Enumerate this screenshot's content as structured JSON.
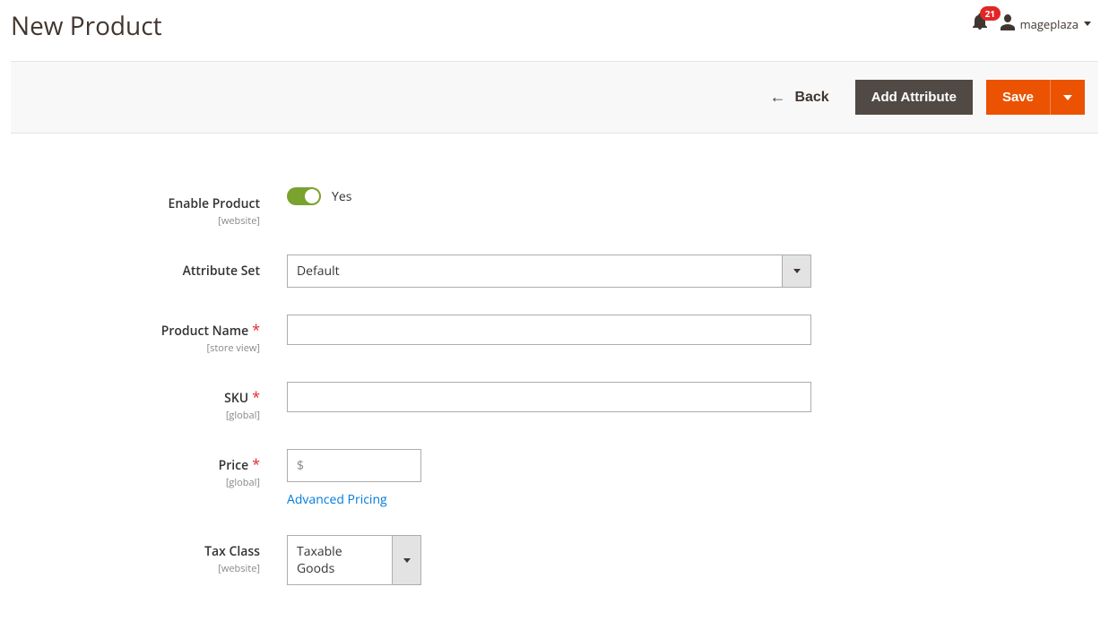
{
  "header": {
    "title": "New Product",
    "notification_count": "21",
    "username": "mageplaza"
  },
  "actions": {
    "back": "Back",
    "add_attribute": "Add Attribute",
    "save": "Save"
  },
  "form": {
    "enable_product": {
      "label": "Enable Product",
      "scope": "[website]",
      "value_label": "Yes"
    },
    "attribute_set": {
      "label": "Attribute Set",
      "value": "Default"
    },
    "product_name": {
      "label": "Product Name",
      "scope": "[store view]",
      "value": ""
    },
    "sku": {
      "label": "SKU",
      "scope": "[global]",
      "value": ""
    },
    "price": {
      "label": "Price",
      "scope": "[global]",
      "prefix": "$",
      "value": "",
      "advanced_link": "Advanced Pricing"
    },
    "tax_class": {
      "label": "Tax Class",
      "scope": "[website]",
      "value": "Taxable Goods"
    }
  }
}
